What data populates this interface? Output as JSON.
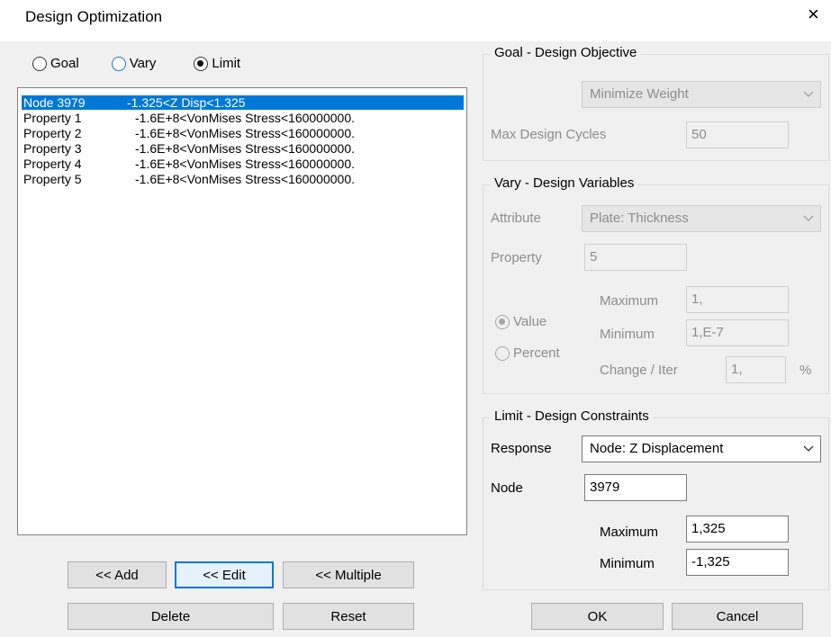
{
  "window": {
    "title": "Design Optimization",
    "close_glyph": "×"
  },
  "mode_radios": [
    {
      "label": "Goal",
      "checked": false
    },
    {
      "label": "Vary",
      "checked": false
    },
    {
      "label": "Limit",
      "checked": true
    }
  ],
  "constraints_list": [
    {
      "name": "Node 3979",
      "constraint": "-1.325<Z Disp<1.325",
      "selected": true
    },
    {
      "name": "Property 1",
      "constraint": "-1.6E+8<VonMises Stress<160000000.",
      "selected": false
    },
    {
      "name": "Property 2",
      "constraint": "-1.6E+8<VonMises Stress<160000000.",
      "selected": false
    },
    {
      "name": "Property 3",
      "constraint": "-1.6E+8<VonMises Stress<160000000.",
      "selected": false
    },
    {
      "name": "Property 4",
      "constraint": "-1.6E+8<VonMises Stress<160000000.",
      "selected": false
    },
    {
      "name": "Property 5",
      "constraint": "-1.6E+8<VonMises Stress<160000000.",
      "selected": false
    }
  ],
  "list_buttons": {
    "add": "<< Add",
    "edit": "<< Edit",
    "multiple": "<< Multiple",
    "delete": "Delete",
    "reset": "Reset"
  },
  "goal": {
    "title": "Goal - Design Objective",
    "objective": "Minimize Weight",
    "max_cycles_label": "Max Design Cycles",
    "max_cycles_value": "50"
  },
  "vary": {
    "title": "Vary - Design Variables",
    "attribute_label": "Attribute",
    "attribute_value": "Plate: Thickness",
    "property_label": "Property",
    "property_value": "5",
    "value_radio": "Value",
    "percent_radio": "Percent",
    "maximum_label": "Maximum",
    "maximum_value": "1,",
    "minimum_label": "Minimum",
    "minimum_value": "1,E-7",
    "change_label": "Change / Iter",
    "change_value": "1,",
    "percent_sign": "%"
  },
  "limit": {
    "title": "Limit - Design Constraints",
    "response_label": "Response",
    "response_value": "Node:  Z Displacement",
    "node_label": "Node",
    "node_value": "3979",
    "maximum_label": "Maximum",
    "maximum_value": "1,325",
    "minimum_label": "Minimum",
    "minimum_value": "-1,325"
  },
  "dialog_buttons": {
    "ok": "OK",
    "cancel": "Cancel"
  },
  "colors": {
    "selection": "#0078d7",
    "focus_border": "#0078d7",
    "dialog_bg": "#f0f0f0",
    "disabled_text": "#8d8d8d"
  }
}
